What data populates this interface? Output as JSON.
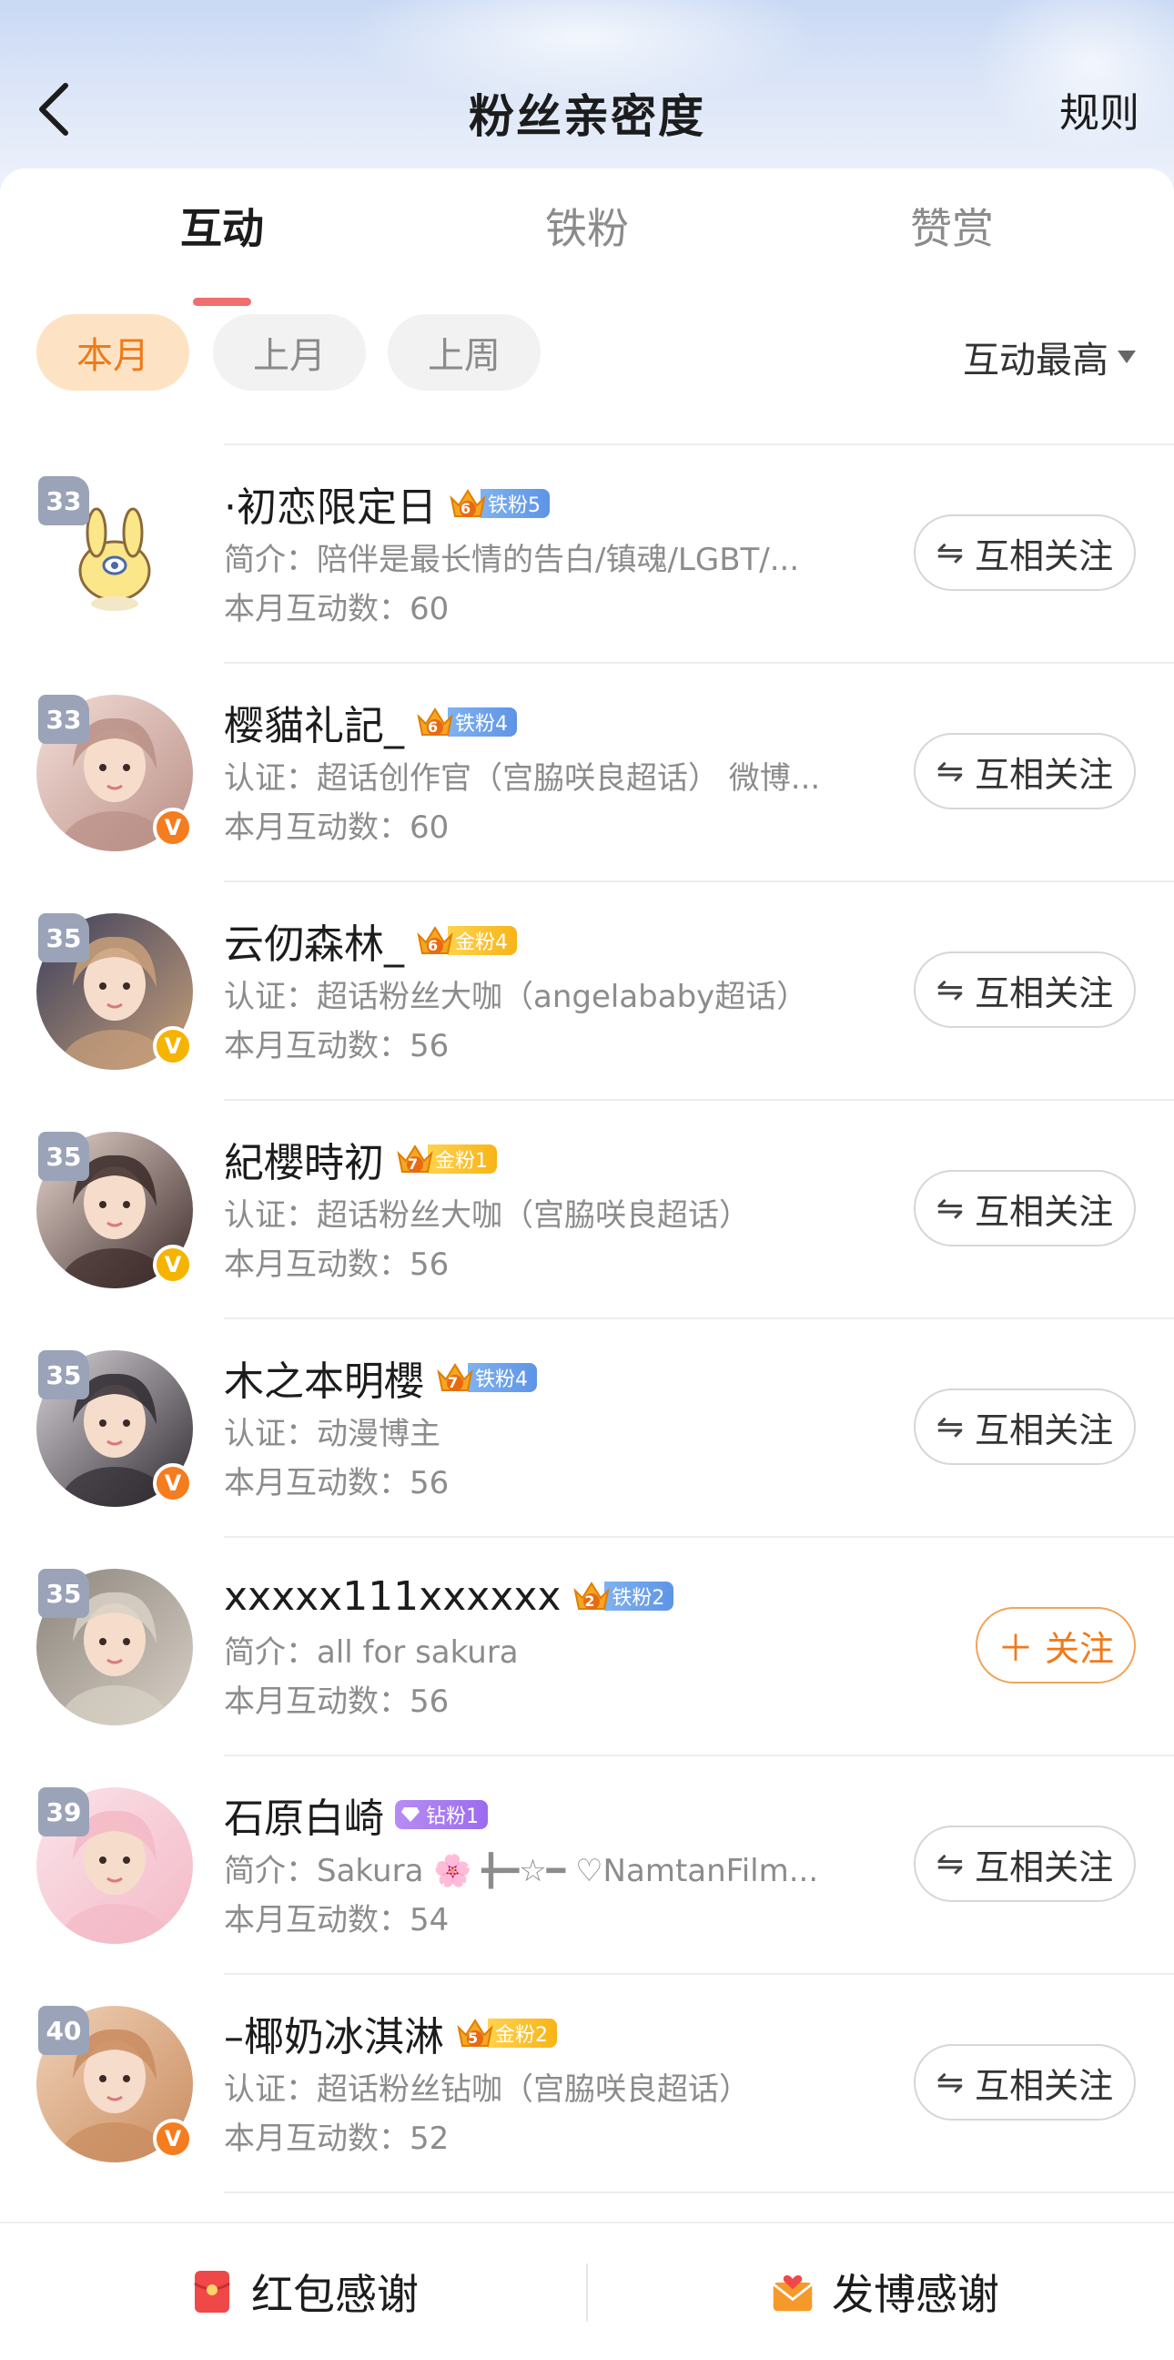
{
  "header": {
    "title": "粉丝亲密度",
    "rules_label": "规则"
  },
  "tabs": [
    {
      "label": "互动",
      "active": true
    },
    {
      "label": "铁粉",
      "active": false
    },
    {
      "label": "赞赏",
      "active": false
    }
  ],
  "filters": [
    {
      "label": "本月",
      "active": true
    },
    {
      "label": "上月",
      "active": false
    },
    {
      "label": "上周",
      "active": false
    }
  ],
  "sort_label": "互动最高",
  "fans": [
    {
      "rank": "33",
      "name": "·初恋限定日",
      "badge_level": "6",
      "badge_label": "铁粉5",
      "badge_type": "iron",
      "desc": "简介：陪伴是最长情的告白/镇魂/LGBT/...",
      "count": "本月互动数：60",
      "verified": "",
      "button": "互相关注",
      "button_type": "mutual"
    },
    {
      "rank": "33",
      "name": "樱貓礼記_",
      "badge_level": "6",
      "badge_label": "铁粉4",
      "badge_type": "iron",
      "desc": "认证：超话创作官（宫脇咲良超话） 微博...",
      "count": "本月互动数：60",
      "verified": "orange",
      "button": "互相关注",
      "button_type": "mutual"
    },
    {
      "rank": "35",
      "name": "云仞森林_",
      "badge_level": "6",
      "badge_label": "金粉4",
      "badge_type": "gold",
      "desc": "认证：超话粉丝大咖（angelababy超话）",
      "count": "本月互动数：56",
      "verified": "gold",
      "button": "互相关注",
      "button_type": "mutual"
    },
    {
      "rank": "35",
      "name": "紀櫻時初",
      "badge_level": "7",
      "badge_label": "金粉1",
      "badge_type": "gold",
      "desc": "认证：超话粉丝大咖（宫脇咲良超话）",
      "count": "本月互动数：56",
      "verified": "gold",
      "button": "互相关注",
      "button_type": "mutual"
    },
    {
      "rank": "35",
      "name": "木之本明櫻",
      "badge_level": "7",
      "badge_label": "铁粉4",
      "badge_type": "iron",
      "desc": "认证：动漫博主",
      "count": "本月互动数：56",
      "verified": "orange",
      "button": "互相关注",
      "button_type": "mutual"
    },
    {
      "rank": "35",
      "name": "xxxxx111xxxxxx",
      "badge_level": "2",
      "badge_label": "铁粉2",
      "badge_type": "iron",
      "desc": "简介：all for sakura",
      "count": "本月互动数：56",
      "verified": "",
      "button": "关注",
      "button_type": "add"
    },
    {
      "rank": "39",
      "name": "石原白崎",
      "badge_level": "",
      "badge_label": "钻粉1",
      "badge_type": "diamond",
      "desc": "简介：Sakura 🌸 ╋━☆━ ♡NamtanFilm...",
      "count": "本月互动数：54",
      "verified": "",
      "button": "互相关注",
      "button_type": "mutual"
    },
    {
      "rank": "40",
      "name": "–椰奶冰淇淋",
      "badge_level": "5",
      "badge_label": "金粉2",
      "badge_type": "gold",
      "desc": "认证：超话粉丝钻咖（宫脇咲良超话）",
      "count": "本月互动数：52",
      "verified": "orange",
      "button": "互相关注",
      "button_type": "mutual"
    }
  ],
  "bottom": {
    "redpacket_label": "红包感谢",
    "post_label": "发博感谢"
  },
  "colors": {
    "accent": "#f07a1a",
    "tab_underline": "#f26d6d",
    "iron": "#5e94e6",
    "gold": "#f7b418",
    "diamond": "#9b6bef"
  }
}
